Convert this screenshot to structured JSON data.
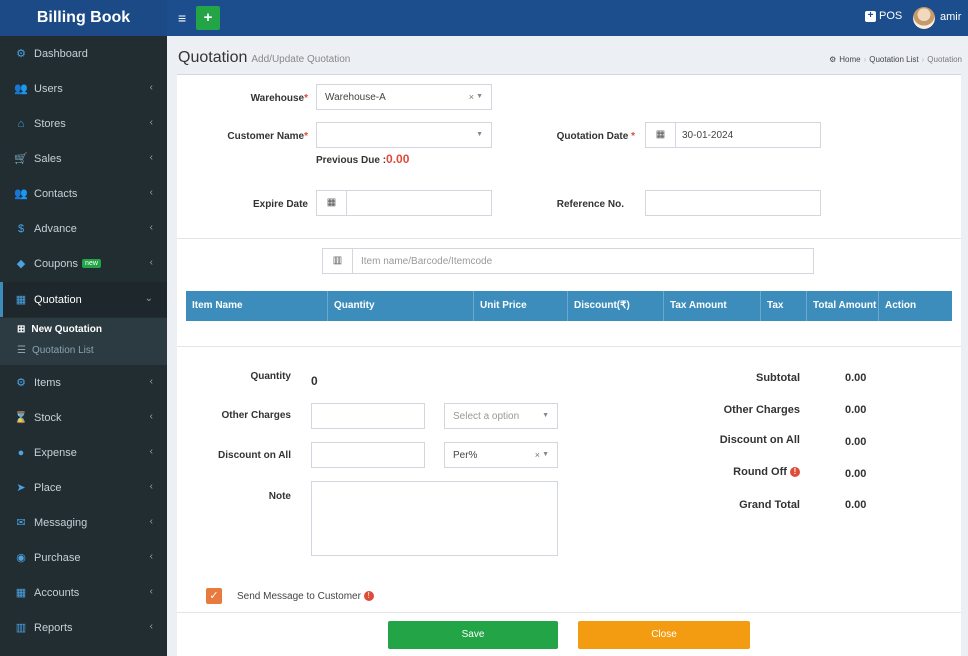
{
  "header": {
    "app_title": "Billing Book",
    "menu_glyph": "≡",
    "add_glyph": "+",
    "pos_label": "POS",
    "user_name": "amir"
  },
  "sidebar": {
    "items": [
      {
        "label": "Dashboard",
        "icon": "dashboard-icon",
        "glyph": "⚙"
      },
      {
        "label": "Users",
        "icon": "users-icon",
        "glyph": "👥"
      },
      {
        "label": "Stores",
        "icon": "home-icon",
        "glyph": "⌂"
      },
      {
        "label": "Sales",
        "icon": "cart-icon",
        "glyph": "🛒"
      },
      {
        "label": "Contacts",
        "icon": "contacts-icon",
        "glyph": "👥"
      },
      {
        "label": "Advance",
        "icon": "dollar-icon",
        "glyph": "$"
      },
      {
        "label": "Coupons",
        "icon": "tag-icon",
        "glyph": "◆",
        "badge": "new"
      },
      {
        "label": "Quotation",
        "icon": "calendar-icon",
        "glyph": "▦"
      },
      {
        "label": "Items",
        "icon": "items-icon",
        "glyph": "⚙"
      },
      {
        "label": "Stock",
        "icon": "hourglass-icon",
        "glyph": "⌛"
      },
      {
        "label": "Expense",
        "icon": "minus-circle-icon",
        "glyph": "●"
      },
      {
        "label": "Place",
        "icon": "location-icon",
        "glyph": "➤"
      },
      {
        "label": "Messaging",
        "icon": "envelope-icon",
        "glyph": "✉"
      },
      {
        "label": "Purchase",
        "icon": "purchase-icon",
        "glyph": "◉"
      },
      {
        "label": "Accounts",
        "icon": "accounts-icon",
        "glyph": "▦"
      },
      {
        "label": "Reports",
        "icon": "bar-chart-icon",
        "glyph": "▥"
      }
    ],
    "submenu": {
      "new_quotation": "New Quotation",
      "quotation_list": "Quotation List"
    }
  },
  "page": {
    "title": "Quotation",
    "subtitle": "Add/Update Quotation",
    "breadcrumb": [
      "Home",
      "Quotation List",
      "Quotation"
    ]
  },
  "form": {
    "warehouse_label": "Warehouse",
    "warehouse_value": "Warehouse-A",
    "customer_label": "Customer Name",
    "customer_value": "",
    "previous_due_label": "Previous Due :",
    "previous_due_value": "0.00",
    "quotation_date_label": "Quotation Date",
    "quotation_date_value": "30-01-2024",
    "expire_date_label": "Expire Date",
    "expire_date_value": "",
    "reference_label": "Reference No.",
    "reference_value": "",
    "item_search_placeholder": "Item name/Barcode/Itemcode"
  },
  "table": {
    "columns": [
      "Item Name",
      "Quantity",
      "Unit Price",
      "Discount(₹)",
      "Tax Amount",
      "Tax",
      "Total Amount",
      "Action"
    ]
  },
  "details": {
    "quantity_label": "Quantity",
    "quantity_value": "0",
    "other_charges_label": "Other Charges",
    "other_charges_value": "",
    "other_charges_select": "Select a option",
    "discount_all_label": "Discount on All",
    "discount_all_value": "",
    "discount_type": "Per%",
    "note_label": "Note",
    "note_value": ""
  },
  "summary": {
    "subtotal_label": "Subtotal",
    "subtotal_value": "0.00",
    "other_charges_label": "Other Charges",
    "other_charges_value": "0.00",
    "discount_label": "Discount on All",
    "discount_value": "0.00",
    "round_off_label": "Round Off",
    "round_off_value": "0.00",
    "grand_total_label": "Grand Total",
    "grand_total_value": "0.00"
  },
  "footer": {
    "send_message_label": "Send Message to Customer",
    "save_label": "Save",
    "close_label": "Close"
  },
  "colors": {
    "header": "#1c4d8c",
    "sidebar": "#222d32",
    "table_header": "#3c8dbc",
    "save": "#22a447",
    "close": "#f39c12",
    "required": "#dd4b39"
  }
}
